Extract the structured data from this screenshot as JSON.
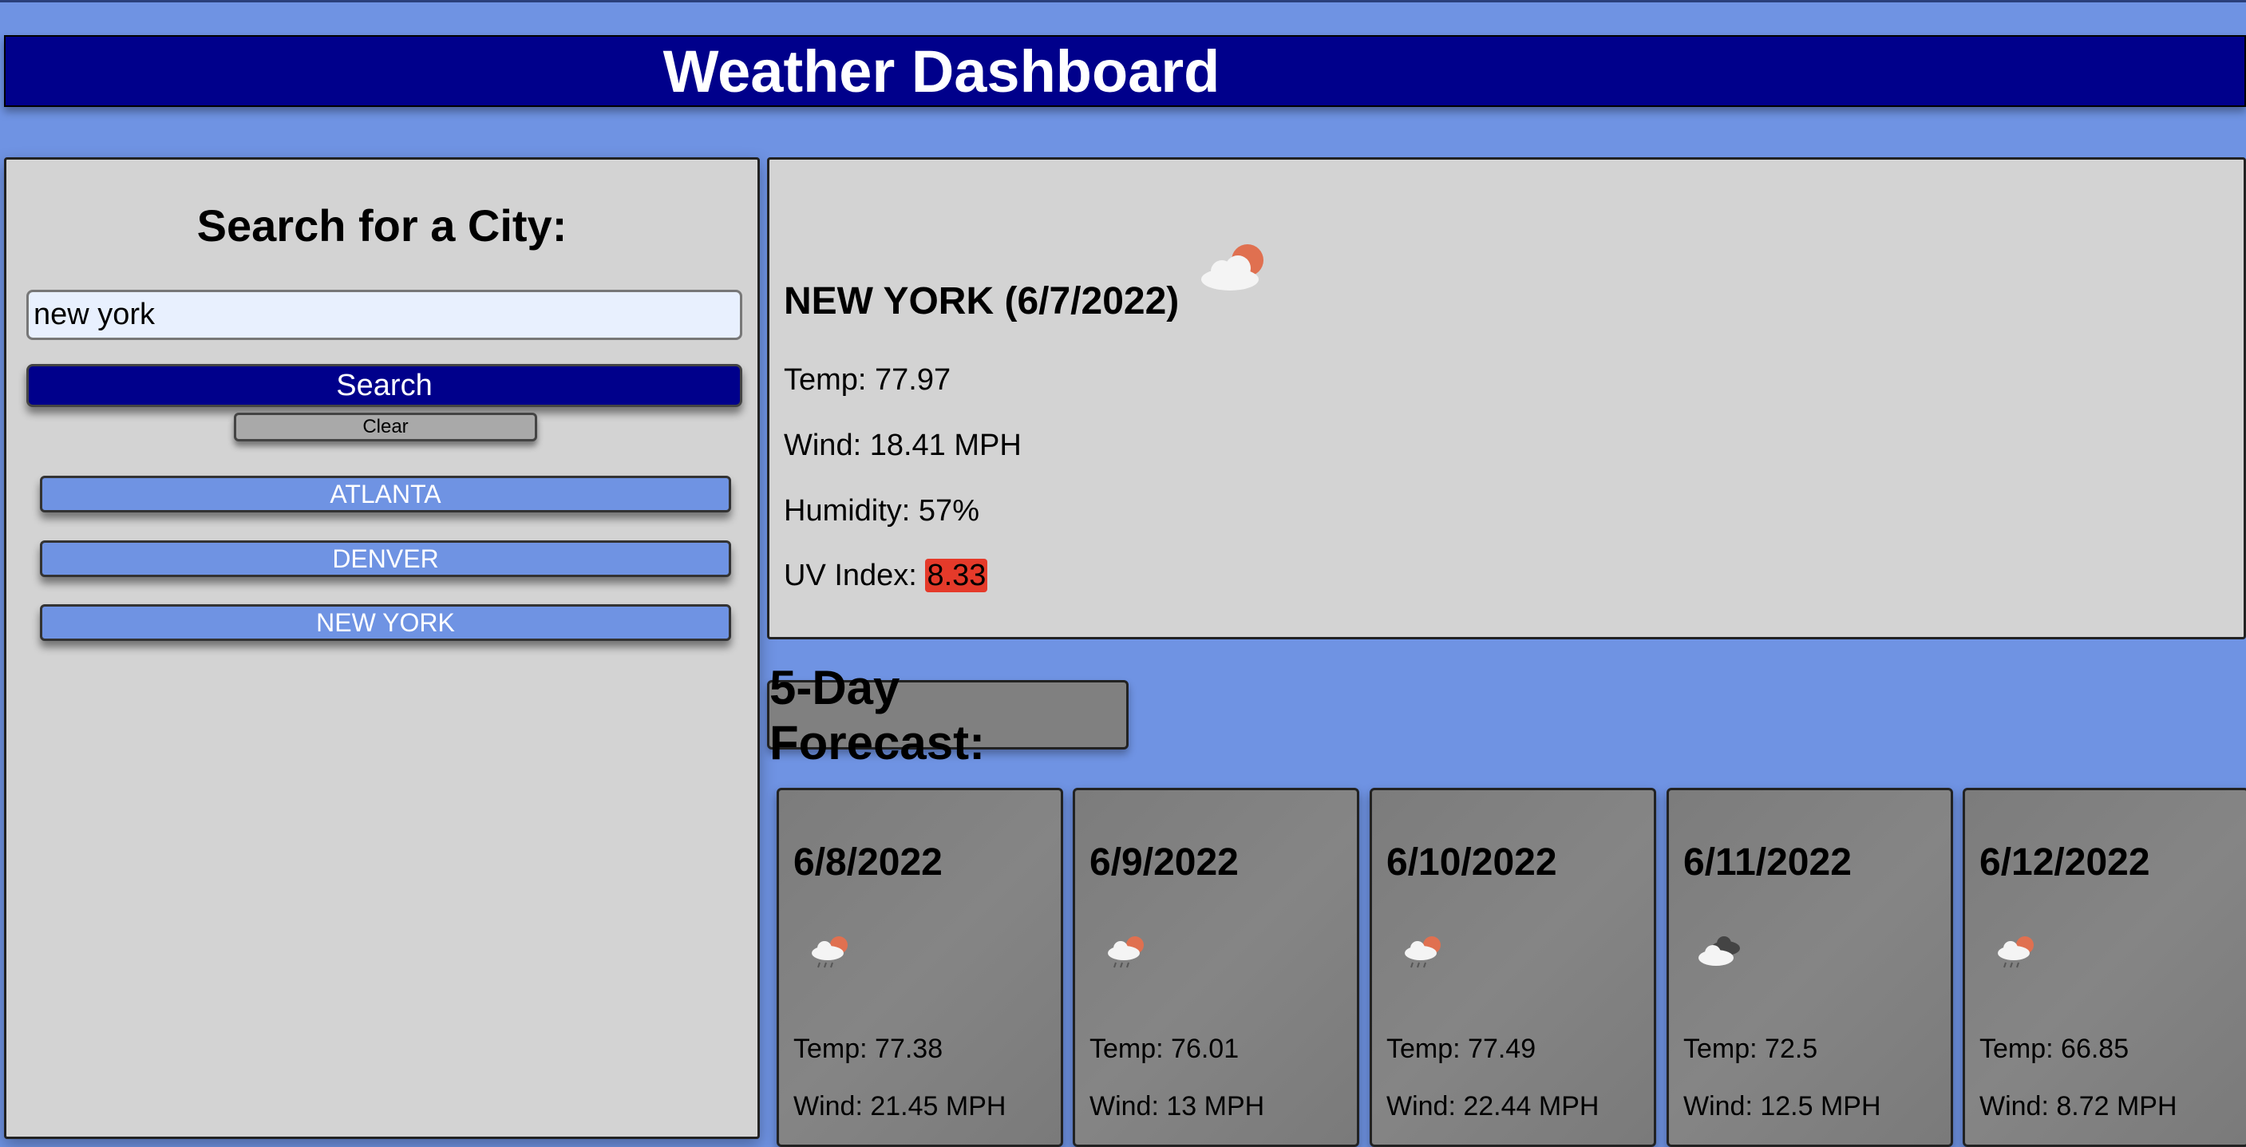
{
  "header": {
    "title": "Weather Dashboard"
  },
  "sidebar": {
    "heading": "Search for a City:",
    "search_value": "new york",
    "search_label": "Search",
    "clear_label": "Clear",
    "history": [
      "ATLANTA",
      "DENVER",
      "NEW YORK"
    ]
  },
  "current": {
    "title": "NEW YORK (6/7/2022)",
    "icon": "cloud-sun-icon",
    "temp": "Temp: 77.97",
    "wind": "Wind: 18.41 MPH",
    "humidity": "Humidity: 57%",
    "uv_label": "UV Index:",
    "uv_value": "8.33",
    "uv_color": "#e53a2a"
  },
  "forecast": {
    "heading": "5-Day Forecast:",
    "days": [
      {
        "date": "6/8/2022",
        "icon": "rain-sun-icon",
        "temp": "Temp: 77.38",
        "wind": "Wind: 21.45 MPH"
      },
      {
        "date": "6/9/2022",
        "icon": "rain-sun-icon",
        "temp": "Temp: 76.01",
        "wind": "Wind: 13 MPH"
      },
      {
        "date": "6/10/2022",
        "icon": "rain-sun-icon",
        "temp": "Temp: 77.49",
        "wind": "Wind: 22.44 MPH"
      },
      {
        "date": "6/11/2022",
        "icon": "broken-clouds-icon",
        "temp": "Temp: 72.5",
        "wind": "Wind: 12.5 MPH"
      },
      {
        "date": "6/12/2022",
        "icon": "rain-sun-icon",
        "temp": "Temp: 66.85",
        "wind": "Wind: 8.72 MPH"
      }
    ]
  },
  "colors": {
    "background": "#6f93e3",
    "header": "#00008b",
    "panel": "#d3d3d3",
    "card": "#808080"
  }
}
